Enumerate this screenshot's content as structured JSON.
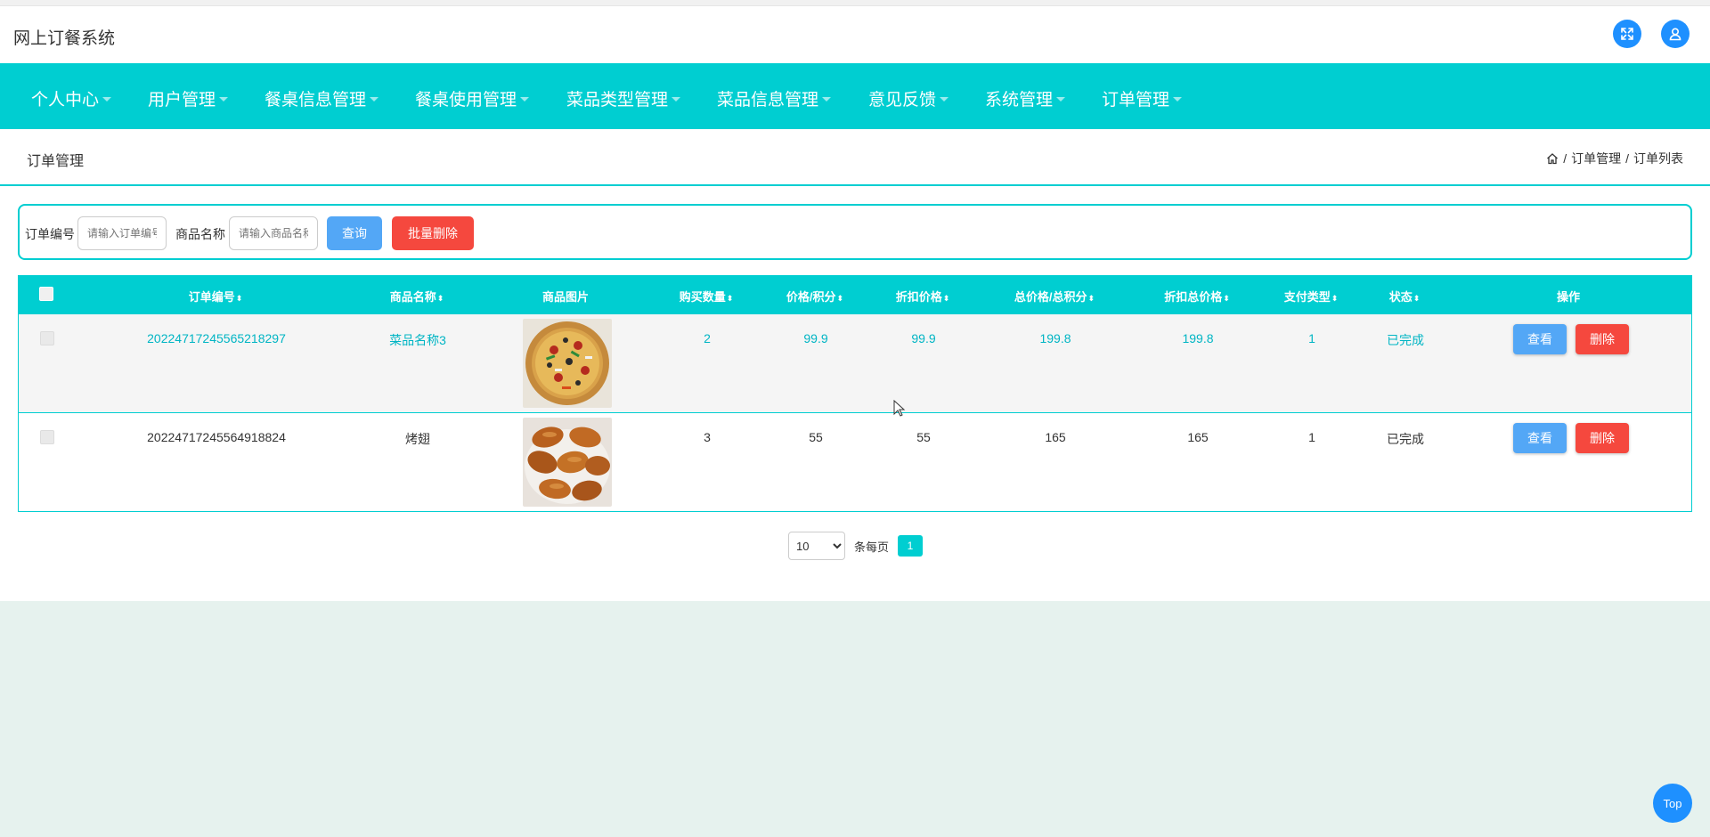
{
  "header": {
    "app_title": "网上订餐系统",
    "fullscreen_icon": "fullscreen-icon",
    "user_icon": "user-icon"
  },
  "nav": [
    {
      "label": "个人中心"
    },
    {
      "label": "用户管理"
    },
    {
      "label": "餐桌信息管理"
    },
    {
      "label": "餐桌使用管理"
    },
    {
      "label": "菜品类型管理"
    },
    {
      "label": "菜品信息管理"
    },
    {
      "label": "意见反馈"
    },
    {
      "label": "系统管理"
    },
    {
      "label": "订单管理"
    }
  ],
  "page": {
    "title": "订单管理",
    "breadcrumb": {
      "home_icon": "home-icon",
      "sep": "/",
      "level1": "订单管理",
      "level2": "订单列表"
    }
  },
  "search": {
    "order_no_label": "订单编号",
    "order_no_placeholder": "请输入订单编号",
    "goods_name_label": "商品名称",
    "goods_name_placeholder": "请输入商品名称",
    "query_label": "查询",
    "batch_delete_label": "批量删除"
  },
  "table": {
    "columns": [
      "订单编号",
      "商品名称",
      "商品图片",
      "购买数量",
      "价格/积分",
      "折扣价格",
      "总价格/总积分",
      "折扣总价格",
      "支付类型",
      "状态",
      "操作"
    ],
    "sort_glyph": "⬍",
    "rows": [
      {
        "order_no": "20224717245565218297",
        "goods_name": "菜品名称3",
        "image": "pizza",
        "quantity": "2",
        "price": "99.9",
        "discount_price": "99.9",
        "total": "199.8",
        "discount_total": "199.8",
        "pay_type": "1",
        "status": "已完成",
        "view_label": "查看",
        "delete_label": "删除"
      },
      {
        "order_no": "20224717245564918824",
        "goods_name": "烤翅",
        "image": "chicken-wings",
        "quantity": "3",
        "price": "55",
        "discount_price": "55",
        "total": "165",
        "discount_total": "165",
        "pay_type": "1",
        "status": "已完成",
        "view_label": "查看",
        "delete_label": "删除"
      }
    ]
  },
  "pagination": {
    "page_size": "10",
    "page_size_options": [
      "10"
    ],
    "per_page_label": "条每页",
    "current_page": "1"
  },
  "back_to_top": "Top",
  "colors": {
    "primary": "#00ced1",
    "blue": "#53a7f6",
    "red": "#f5483e",
    "background": "#e6f2ee"
  }
}
